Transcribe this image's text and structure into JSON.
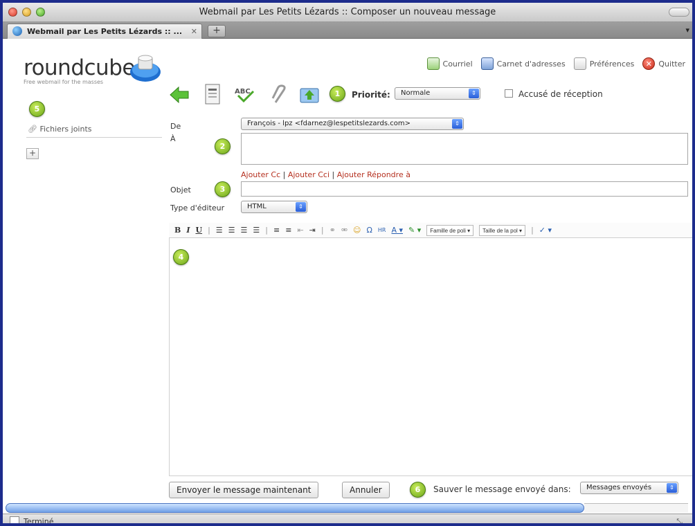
{
  "window": {
    "title": "Webmail par Les Petits Lézards :: Composer un nouveau message",
    "tab_label": "Webmail par Les Petits Lézards :: ...",
    "tab_close": "✕",
    "new_tab": "+"
  },
  "logo": {
    "brand": "roundcube",
    "tagline": "Free webmail for the masses"
  },
  "topnav": {
    "items": [
      {
        "label": "Courriel",
        "icon": "mail-icon"
      },
      {
        "label": "Carnet d'adresses",
        "icon": "address-book-icon"
      },
      {
        "label": "Préférences",
        "icon": "preferences-icon"
      },
      {
        "label": "Quitter",
        "icon": "quit-icon"
      }
    ]
  },
  "markers": [
    "1",
    "2",
    "3",
    "4",
    "5",
    "6"
  ],
  "compose_toolbar": {
    "priority_label": "Priorité:",
    "priority_value": "Normale",
    "receipt_label": "Accusé de réception",
    "receipt_checked": false
  },
  "form": {
    "from_label": "De",
    "from_value": "François - lpz <fdarnez@lespetitslezards.com>",
    "to_label": "À",
    "to_value": "",
    "add_cc": "Ajouter Cc",
    "add_bcc": "Ajouter Cci",
    "add_reply_to": "Ajouter Répondre à",
    "subject_label": "Objet",
    "subject_value": "",
    "editor_type_label": "Type d'éditeur",
    "editor_type_value": "HTML"
  },
  "editor_toolbar": {
    "bold": "B",
    "italic": "I",
    "underline": "U",
    "font_family": "Famille de poli",
    "font_size": "Taille de la pol"
  },
  "sidebar": {
    "attachments_label": "Fichiers joints",
    "add_button": "+"
  },
  "footer": {
    "send_button": "Envoyer le message maintenant",
    "cancel_button": "Annuler",
    "save_in_label": "Sauver le message envoyé dans:",
    "save_in_value": "Messages envoyés"
  },
  "status": {
    "text": "Terminé"
  },
  "colors": {
    "accent_red": "#b5301f",
    "marker_green": "#6ba51a",
    "window_border": "#1d2c8c"
  }
}
